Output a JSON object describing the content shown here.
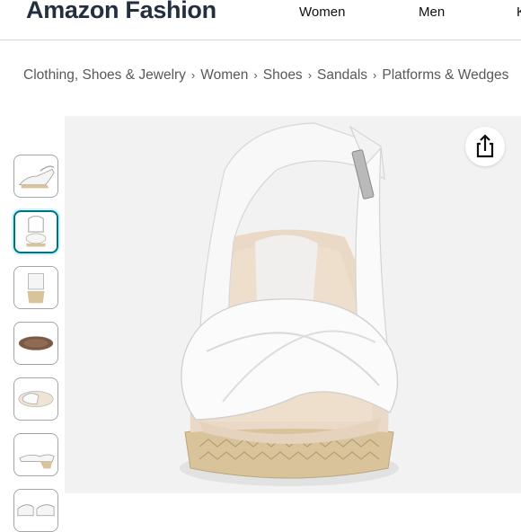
{
  "header": {
    "brand": "Amazon Fashion",
    "nav": [
      "Women",
      "Men",
      "K"
    ]
  },
  "breadcrumb": [
    "Clothing, Shoes & Jewelry",
    "Women",
    "Shoes",
    "Sandals",
    "Platforms & Wedges"
  ],
  "breadcrumb_separator": "›",
  "thumbnails": [
    {
      "view": "side-view",
      "selected": false
    },
    {
      "view": "front-view",
      "selected": true
    },
    {
      "view": "back-view",
      "selected": false
    },
    {
      "view": "sole-view",
      "selected": false
    },
    {
      "view": "top-view",
      "selected": false
    },
    {
      "view": "side-view-2",
      "selected": false
    },
    {
      "view": "pair-view",
      "selected": false
    }
  ],
  "icons": {
    "share": "share-icon"
  },
  "colors": {
    "brand": "#232f3e",
    "selected_thumb": "#007185",
    "background": "#ffffff"
  }
}
